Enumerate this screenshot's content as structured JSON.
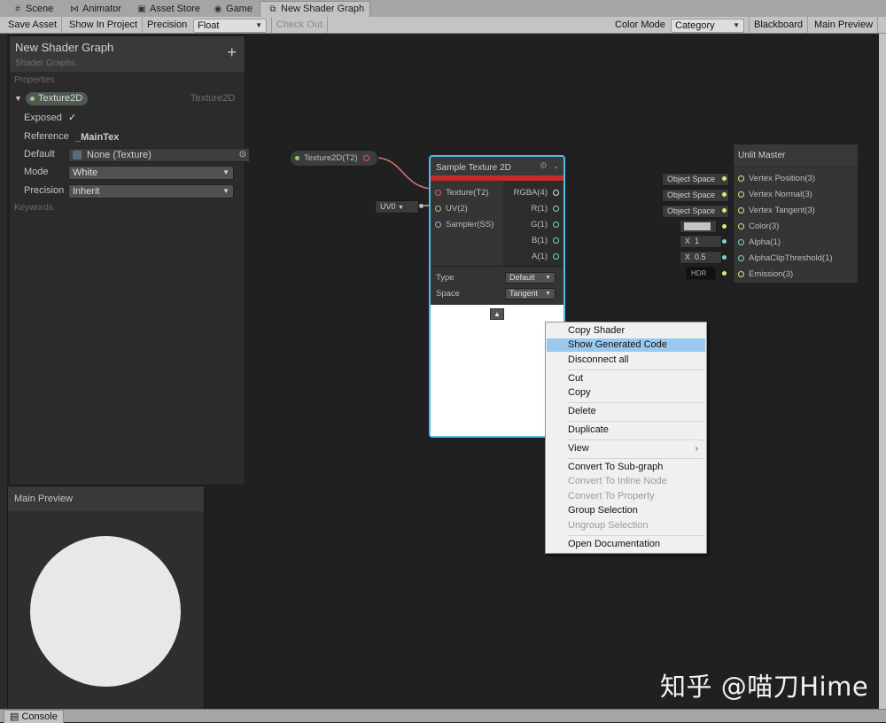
{
  "tabs": [
    {
      "label": "Scene",
      "icon": "grid-icon"
    },
    {
      "label": "Animator",
      "icon": "animator-icon"
    },
    {
      "label": "Asset Store",
      "icon": "store-icon"
    },
    {
      "label": "Game",
      "icon": "gamepad-icon"
    },
    {
      "label": "New Shader Graph",
      "icon": "shader-graph-icon"
    }
  ],
  "toolbar": {
    "save_asset": "Save Asset",
    "show_in_project": "Show In Project",
    "precision_label": "Precision",
    "precision_value": "Float",
    "check_out": "Check Out",
    "color_mode_label": "Color Mode",
    "color_mode_value": "Category",
    "blackboard": "Blackboard",
    "main_preview": "Main Preview"
  },
  "blackboard": {
    "title": "New Shader Graph",
    "subtitle": "Shader Graphs",
    "add_icon": "+",
    "section_properties": "Properties",
    "property_name": "Texture2D",
    "property_type": "Texture2D",
    "exposed_label": "Exposed",
    "exposed_check": "✓",
    "reference_label": "Reference",
    "reference_value": "_MainTex",
    "default_label": "Default",
    "default_value": "None (Texture)",
    "mode_label": "Mode",
    "mode_value": "White",
    "precision_label": "Precision",
    "precision_value": "Inherit",
    "section_keywords": "Keywords"
  },
  "preview": {
    "title": "Main Preview"
  },
  "property_node": {
    "label": "Texture2D(T2)"
  },
  "uv_node": {
    "value": "UV0"
  },
  "sample_node": {
    "title": "Sample Texture 2D",
    "inputs": [
      "Texture(T2)",
      "UV(2)",
      "Sampler(SS)"
    ],
    "outputs": [
      "RGBA(4)",
      "R(1)",
      "G(1)",
      "B(1)",
      "A(1)"
    ],
    "type_label": "Type",
    "type_value": "Default",
    "space_label": "Space",
    "space_value": "Tangent"
  },
  "master_node": {
    "title": "Unlit Master",
    "ports": [
      "Vertex Position(3)",
      "Vertex Normal(3)",
      "Vertex Tangent(3)",
      "Color(3)",
      "Alpha(1)",
      "AlphaClipThreshold(1)",
      "Emission(3)"
    ],
    "space_inputs": [
      "Object Space",
      "Object Space",
      "Object Space"
    ],
    "alpha_axis": "X",
    "alpha_value": "1",
    "clip_axis": "X",
    "clip_value": "0.5",
    "emission_value": "HDR"
  },
  "context_menu": {
    "items": [
      "Copy Shader",
      "Show Generated Code",
      "Disconnect all",
      "Cut",
      "Copy",
      "Delete",
      "Duplicate",
      "View",
      "Convert To Sub-graph",
      "Convert To Inline Node",
      "Convert To Property",
      "Group Selection",
      "Ungroup Selection",
      "Open Documentation"
    ],
    "submenu_arrow": "›"
  },
  "console_tab": "Console",
  "watermark": "知乎 @喵刀Hime",
  "colors": {
    "selection": "#99c9ef",
    "node_selected_border": "#58b8e6",
    "texture_red": "#c52a2a",
    "edge_pink": "#e07474"
  }
}
